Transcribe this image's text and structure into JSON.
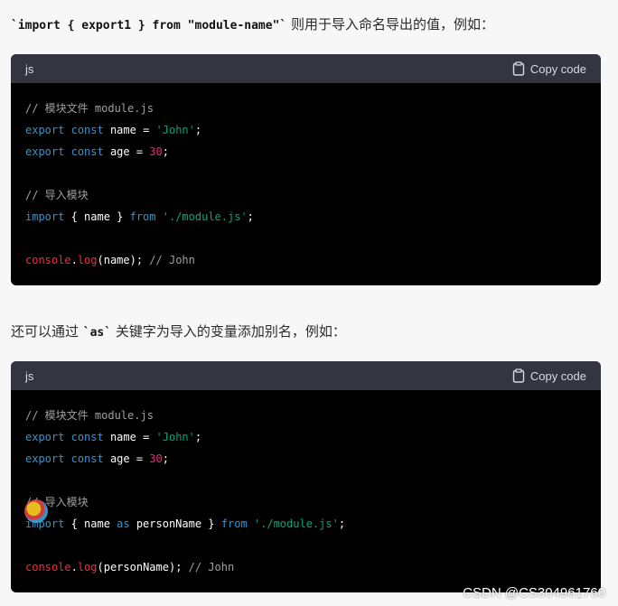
{
  "intro": {
    "code": "`import { export1 } from \"module-name\"`",
    "text": " 则用于导入命名导出的值，例如："
  },
  "block1": {
    "lang": "js",
    "copy_label": "Copy code",
    "lines": [
      [
        {
          "t": "// 模块文件 module.js",
          "c": "cm"
        }
      ],
      [
        {
          "t": "export",
          "c": "kw"
        },
        {
          "t": " ",
          "c": "pl"
        },
        {
          "t": "const",
          "c": "kw"
        },
        {
          "t": " name = ",
          "c": "pl"
        },
        {
          "t": "'John'",
          "c": "str"
        },
        {
          "t": ";",
          "c": "pl"
        }
      ],
      [
        {
          "t": "export",
          "c": "kw"
        },
        {
          "t": " ",
          "c": "pl"
        },
        {
          "t": "const",
          "c": "kw"
        },
        {
          "t": " age = ",
          "c": "pl"
        },
        {
          "t": "30",
          "c": "num"
        },
        {
          "t": ";",
          "c": "pl"
        }
      ],
      [],
      [
        {
          "t": "// 导入模块",
          "c": "cm"
        }
      ],
      [
        {
          "t": "import",
          "c": "kw"
        },
        {
          "t": " { name } ",
          "c": "pl"
        },
        {
          "t": "from",
          "c": "kw"
        },
        {
          "t": " ",
          "c": "pl"
        },
        {
          "t": "'./module.js'",
          "c": "str"
        },
        {
          "t": ";",
          "c": "pl"
        }
      ],
      [],
      [
        {
          "t": "console",
          "c": "obj"
        },
        {
          "t": ".",
          "c": "pl"
        },
        {
          "t": "log",
          "c": "obj"
        },
        {
          "t": "(name); ",
          "c": "pl"
        },
        {
          "t": "// John",
          "c": "cm"
        }
      ]
    ]
  },
  "middle": {
    "prefix": "还可以通过 ",
    "code": "`as`",
    "suffix": " 关键字为导入的变量添加别名，例如："
  },
  "block2": {
    "lang": "js",
    "copy_label": "Copy code",
    "lines": [
      [
        {
          "t": "// 模块文件 module.js",
          "c": "cm"
        }
      ],
      [
        {
          "t": "export",
          "c": "kw"
        },
        {
          "t": " ",
          "c": "pl"
        },
        {
          "t": "const",
          "c": "kw"
        },
        {
          "t": " name = ",
          "c": "pl"
        },
        {
          "t": "'John'",
          "c": "str"
        },
        {
          "t": ";",
          "c": "pl"
        }
      ],
      [
        {
          "t": "export",
          "c": "kw"
        },
        {
          "t": " ",
          "c": "pl"
        },
        {
          "t": "const",
          "c": "kw"
        },
        {
          "t": " age = ",
          "c": "pl"
        },
        {
          "t": "30",
          "c": "num"
        },
        {
          "t": ";",
          "c": "pl"
        }
      ],
      [],
      [
        {
          "t": "// 导入模块",
          "c": "cm"
        }
      ],
      [
        {
          "t": "import",
          "c": "kw"
        },
        {
          "t": " { name ",
          "c": "pl"
        },
        {
          "t": "as",
          "c": "kw"
        },
        {
          "t": " personName } ",
          "c": "pl"
        },
        {
          "t": "from",
          "c": "kw"
        },
        {
          "t": " ",
          "c": "pl"
        },
        {
          "t": "'./module.js'",
          "c": "str"
        },
        {
          "t": ";",
          "c": "pl"
        }
      ],
      [],
      [
        {
          "t": "console",
          "c": "obj"
        },
        {
          "t": ".",
          "c": "pl"
        },
        {
          "t": "log",
          "c": "obj"
        },
        {
          "t": "(personName); ",
          "c": "pl"
        },
        {
          "t": "// John",
          "c": "cm"
        }
      ]
    ]
  },
  "watermark": "CSDN @CS304961760",
  "colors": {
    "page_bg": "#f7f7f8",
    "code_bg": "#000000",
    "header_bg": "#343541",
    "keyword": "#2e95d3",
    "string": "#00a67d",
    "number": "#df3079",
    "object": "#f22c3d",
    "comment": "#a0a0a0"
  }
}
